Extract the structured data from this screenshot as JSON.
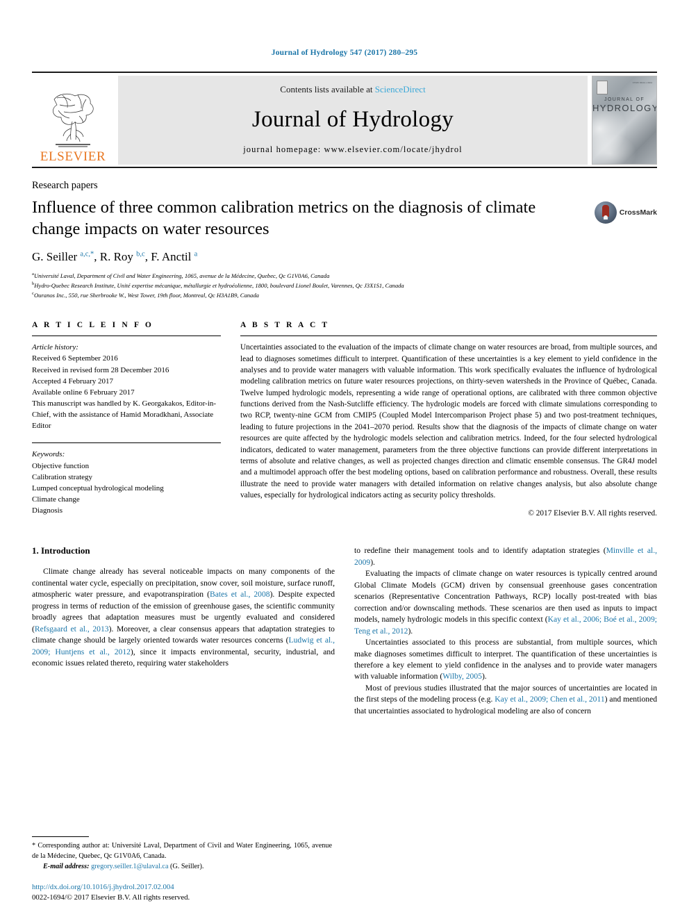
{
  "running_head": "Journal of Hydrology 547 (2017) 280–295",
  "masthead": {
    "contents_prefix": "Contents lists available at ",
    "contents_link": "ScienceDirect",
    "journal_name": "Journal of Hydrology",
    "homepage": "journal homepage: www.elsevier.com/locate/jhydrol",
    "publisher": "ELSEVIER",
    "cover": {
      "title_line1": "JOURNAL OF",
      "title_line2": "HYDROLOGY",
      "issn": "ISSN 0022-1694"
    }
  },
  "article": {
    "section_label": "Research papers",
    "title": "Influence of three common calibration metrics on the diagnosis of climate change impacts on water resources",
    "crossmark_label": "CrossMark",
    "authors_html": "G. Seiller <sup>a,c,</sup><sup>*</sup>, R. Roy <sup>b,c</sup>, F. Anctil <sup>a</sup>",
    "affiliations": [
      {
        "marker": "a",
        "text": "Université Laval, Department of Civil and Water Engineering, 1065, avenue de la Médecine, Quebec, Qc G1V0A6, Canada"
      },
      {
        "marker": "b",
        "text": "Hydro-Quebec Research Institute, Unité expertise mécanique, métallurgie et hydroéolienne, 1800, boulevard Lionel Boulet, Varennes, Qc J3X1S1, Canada"
      },
      {
        "marker": "c",
        "text": "Ouranos Inc., 550, rue Sherbrooke W., West Tower, 19th floor, Montreal, Qc H3A1B9, Canada"
      }
    ]
  },
  "article_info": {
    "heading": "A R T I C L E    I N F O",
    "history_label": "Article history:",
    "history": [
      "Received 6 September 2016",
      "Received in revised form 28 December 2016",
      "Accepted 4 February 2017",
      "Available online 6 February 2017",
      "This manuscript was handled by K. Georgakakos, Editor-in-Chief, with the assistance of Hamid Moradkhani, Associate Editor"
    ],
    "keywords_label": "Keywords:",
    "keywords": [
      "Objective function",
      "Calibration strategy",
      "Lumped conceptual hydrological modeling",
      "Climate change",
      "Diagnosis"
    ]
  },
  "abstract": {
    "heading": "A B S T R A C T",
    "text": "Uncertainties associated to the evaluation of the impacts of climate change on water resources are broad, from multiple sources, and lead to diagnoses sometimes difficult to interpret. Quantification of these uncertainties is a key element to yield confidence in the analyses and to provide water managers with valuable information. This work specifically evaluates the influence of hydrological modeling calibration metrics on future water resources projections, on thirty-seven watersheds in the Province of Québec, Canada. Twelve lumped hydrologic models, representing a wide range of operational options, are calibrated with three common objective functions derived from the Nash-Sutcliffe efficiency. The hydrologic models are forced with climate simulations corresponding to two RCP, twenty-nine GCM from CMIP5 (Coupled Model Intercomparison Project phase 5) and two post-treatment techniques, leading to future projections in the 2041–2070 period. Results show that the diagnosis of the impacts of climate change on water resources are quite affected by the hydrologic models selection and calibration metrics. Indeed, for the four selected hydrological indicators, dedicated to water management, parameters from the three objective functions can provide different interpretations in terms of absolute and relative changes, as well as projected changes direction and climatic ensemble consensus. The GR4J model and a multimodel approach offer the best modeling options, based on calibration performance and robustness. Overall, these results illustrate the need to provide water managers with detailed information on relative changes analysis, but also absolute change values, especially for hydrological indicators acting as security policy thresholds.",
    "copyright": "© 2017 Elsevier B.V. All rights reserved."
  },
  "body": {
    "intro_heading": "1. Introduction",
    "left_paragraphs": [
      {
        "segments": [
          {
            "t": "Climate change already has several noticeable impacts on many components of the continental water cycle, especially on precipitation, snow cover, soil moisture, surface runoff, atmospheric water pressure, and evapotranspiration (",
            "link": false
          },
          {
            "t": "Bates et al., 2008",
            "link": true
          },
          {
            "t": "). Despite expected progress in terms of reduction of the emission of greenhouse gases, the scientific community broadly agrees that adaptation measures must be urgently evaluated and considered (",
            "link": false
          },
          {
            "t": "Refsgaard et al., 2013",
            "link": true
          },
          {
            "t": "). Moreover, a clear consensus appears that adaptation strategies to climate change should be largely oriented towards water resources concerns (",
            "link": false
          },
          {
            "t": "Ludwig et al., 2009; Huntjens et al., 2012",
            "link": true
          },
          {
            "t": "), since it impacts environmental, security, industrial, and economic issues related thereto, requiring water stakeholders",
            "link": false
          }
        ]
      }
    ],
    "right_paragraphs": [
      {
        "indent": false,
        "segments": [
          {
            "t": "to redefine their management tools and to identify adaptation strategies (",
            "link": false
          },
          {
            "t": "Minville et al., 2009",
            "link": true
          },
          {
            "t": ").",
            "link": false
          }
        ]
      },
      {
        "indent": true,
        "segments": [
          {
            "t": "Evaluating the impacts of climate change on water resources is typically centred around Global Climate Models (GCM) driven by consensual greenhouse gases concentration scenarios (Representative Concentration Pathways, RCP) locally post-treated with bias correction and/or downscaling methods. These scenarios are then used as inputs to impact models, namely hydrologic models in this specific context (",
            "link": false
          },
          {
            "t": "Kay et al., 2006; Boé et al., 2009; Teng et al., 2012",
            "link": true
          },
          {
            "t": ").",
            "link": false
          }
        ]
      },
      {
        "indent": true,
        "segments": [
          {
            "t": "Uncertainties associated to this process are substantial, from multiple sources, which make diagnoses sometimes difficult to interpret. The quantification of these uncertainties is therefore a key element to yield confidence in the analyses and to provide water managers with valuable information (",
            "link": false
          },
          {
            "t": "Wilby, 2005",
            "link": true
          },
          {
            "t": ").",
            "link": false
          }
        ]
      },
      {
        "indent": true,
        "segments": [
          {
            "t": "Most of previous studies illustrated that the major sources of uncertainties are located in the first steps of the modeling process (e.g. ",
            "link": false
          },
          {
            "t": "Kay et al., 2009; Chen et al., 2011",
            "link": true
          },
          {
            "t": ") and mentioned that uncertainties associated to hydrological modeling are also of concern",
            "link": false
          }
        ]
      }
    ]
  },
  "footnotes": {
    "corresponding": "* Corresponding author at: Université Laval, Department of Civil and Water Engineering, 1065, avenue de la Médecine, Quebec, Qc G1V0A6, Canada.",
    "email_label": "E-mail address:",
    "email": "gregory.seiller.1@ulaval.ca",
    "email_suffix": "(G. Seiller).",
    "doi": "http://dx.doi.org/10.1016/j.jhydrol.2017.02.004",
    "issn_line": "0022-1694/© 2017 Elsevier B.V. All rights reserved."
  },
  "colors": {
    "link": "#1a75a8",
    "sciencedirect": "#3ba8d8",
    "elsevier_orange": "#e87722",
    "masthead_bg": "#e6e6e6"
  }
}
